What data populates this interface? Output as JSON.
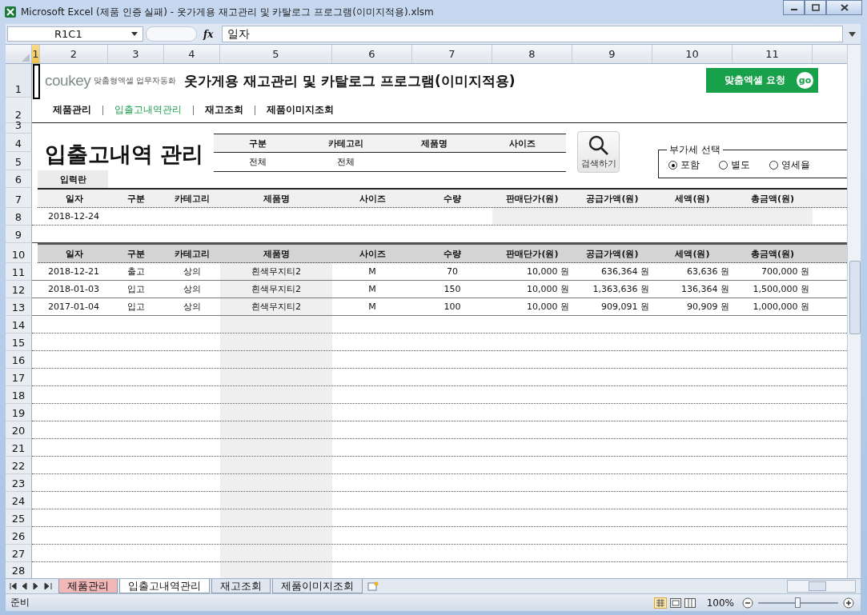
{
  "window": {
    "title": "Microsoft Excel (제품 인증 실패) - 옷가게용 재고관리 및 카탈로그 프로그램(이미지적용).xlsm"
  },
  "formula_bar": {
    "name_box": "R1C1",
    "function_label": "fx",
    "value": "일자"
  },
  "column_headers": [
    {
      "label": "1",
      "selected": true
    },
    {
      "label": "2",
      "selected": false
    },
    {
      "label": "3",
      "selected": false
    },
    {
      "label": "4",
      "selected": false
    },
    {
      "label": "5",
      "selected": false
    },
    {
      "label": "6",
      "selected": false
    },
    {
      "label": "7",
      "selected": false
    },
    {
      "label": "8",
      "selected": false
    },
    {
      "label": "9",
      "selected": false
    },
    {
      "label": "10",
      "selected": false
    },
    {
      "label": "11",
      "selected": false
    }
  ],
  "row_headers": [
    "1",
    "2",
    "3",
    "4",
    "5",
    "6",
    "7",
    "8",
    "9",
    "10",
    "11",
    "12",
    "13",
    "14",
    "15",
    "16",
    "17",
    "18",
    "19",
    "20",
    "21",
    "22",
    "23",
    "24",
    "25",
    "26",
    "27",
    "28"
  ],
  "header": {
    "logo": "coukey",
    "tagline": "맞춤형엑셀 업무자동화",
    "title": "옷가게용 재고관리 및 카탈로그 프로그램(이미지적용)",
    "request_button": "맞춤엑셀 요청",
    "go_badge": "go"
  },
  "nav": [
    {
      "label": "제품관리",
      "selected": false
    },
    {
      "label": "입출고내역관리",
      "selected": true
    },
    {
      "label": "재고조회",
      "selected": false
    },
    {
      "label": "제품이미지조회",
      "selected": false
    }
  ],
  "page_title": "입출고내역 관리",
  "filters": [
    {
      "label": "구분",
      "value": "전체"
    },
    {
      "label": "카테고리",
      "value": "전체"
    },
    {
      "label": "제품명"
    },
    {
      "label": "사이즈"
    }
  ],
  "search_button": "검색하기",
  "vat": {
    "legend": "부가세 선택",
    "options": [
      {
        "label": "포함",
        "selected": true
      },
      {
        "label": "별도",
        "selected": false
      },
      {
        "label": "영세율",
        "selected": false
      }
    ]
  },
  "input_section": {
    "label": "입력란",
    "columns": [
      "일자",
      "구분",
      "카테고리",
      "제품명",
      "사이즈",
      "수량",
      "판매단가(원)",
      "공급가액(원)",
      "세액(원)",
      "총금액(원)"
    ],
    "date": "2018-12-24"
  },
  "list": {
    "columns": [
      "일자",
      "구분",
      "카테고리",
      "제품명",
      "사이즈",
      "수량",
      "판매단가(원)",
      "공급가액(원)",
      "세액(원)",
      "총금액(원)"
    ],
    "rows": [
      [
        "2018-12-21",
        "출고",
        "상의",
        "흰색무지티2",
        "M",
        "70",
        "10,000 원",
        "636,364 원",
        "63,636 원",
        "700,000 원"
      ],
      [
        "2018-01-03",
        "입고",
        "상의",
        "흰색무지티2",
        "M",
        "150",
        "10,000 원",
        "1,363,636 원",
        "136,364 원",
        "1,500,000 원"
      ],
      [
        "2017-01-04",
        "입고",
        "상의",
        "흰색무지티2",
        "M",
        "100",
        "10,000 원",
        "909,091 원",
        "90,909 원",
        "1,000,000 원"
      ]
    ]
  },
  "sheet_tabs": [
    {
      "label": "제품관리",
      "selected": false,
      "color": "#f2b8b8"
    },
    {
      "label": "입출고내역관리",
      "selected": true
    },
    {
      "label": "재고조회",
      "selected": false
    },
    {
      "label": "제품이미지조회",
      "selected": false
    }
  ],
  "status_bar": {
    "text": "준비",
    "zoom": "100%",
    "zoom_slider": {
      "level": 0.5
    }
  }
}
